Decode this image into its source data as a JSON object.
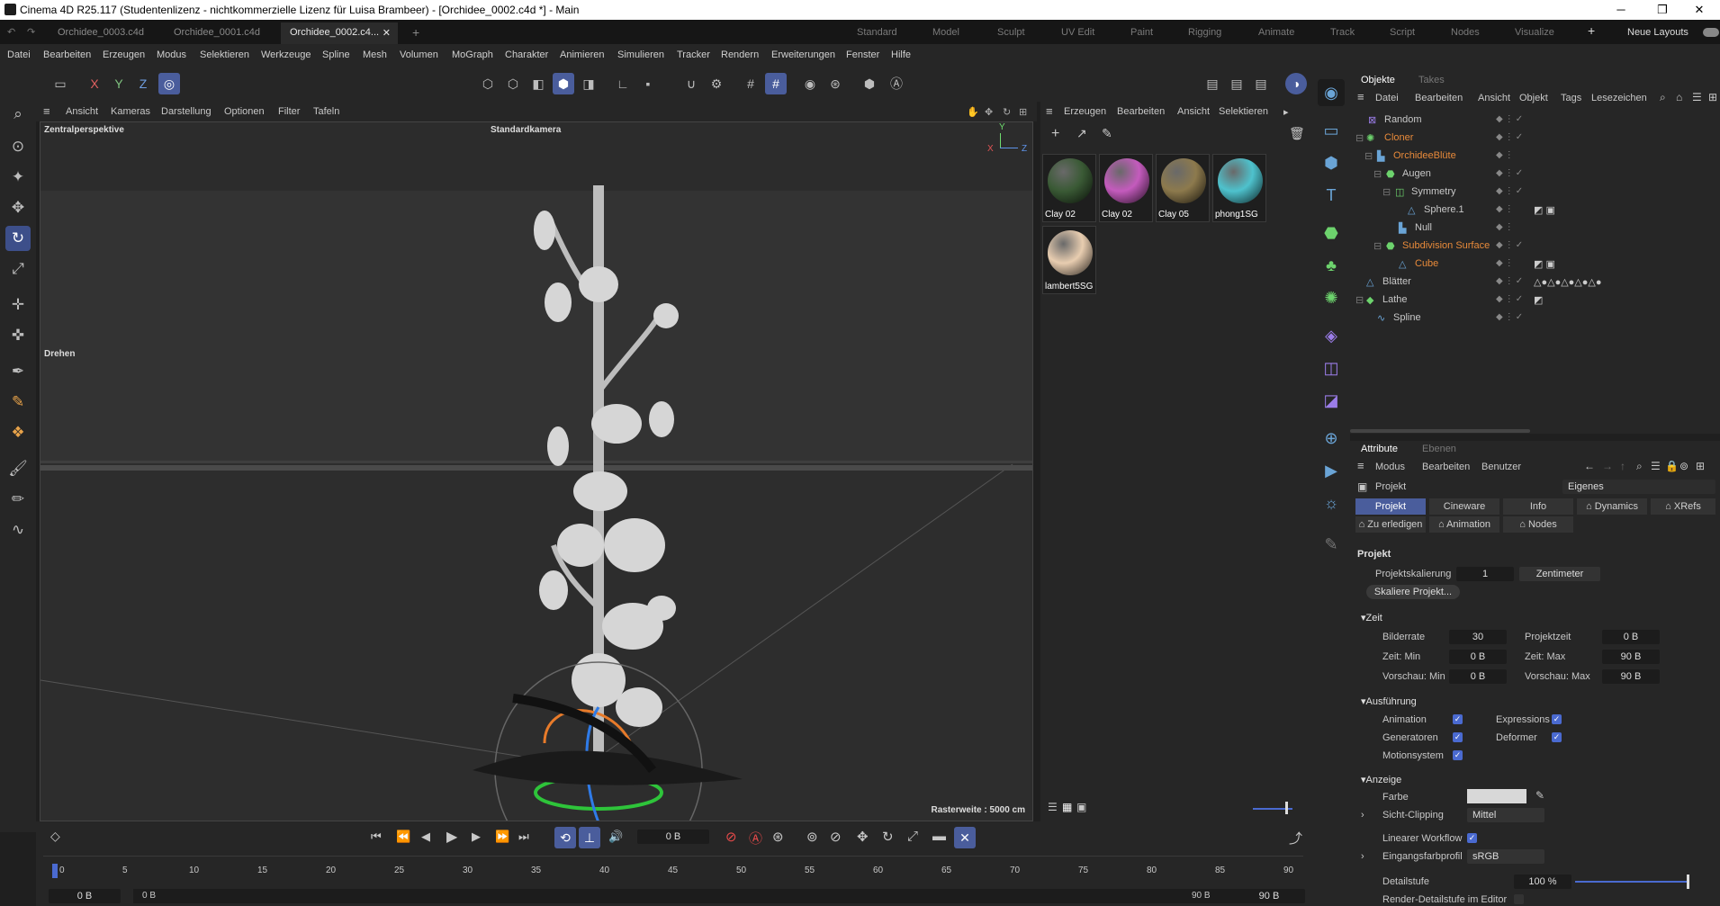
{
  "window": {
    "title": "Cinema 4D R25.117 (Studentenlizenz - nichtkommerzielle Lizenz für Luisa Brambeer) - [Orchidee_0002.c4d *] - Main",
    "minimize": "─",
    "maximize": "❐",
    "close": "✕"
  },
  "doc_tabs": [
    "Orchidee_0003.c4d",
    "Orchidee_0001.c4d",
    "Orchidee_0002.c4...",
    "✕",
    "+"
  ],
  "layouts": [
    "Standard",
    "Model",
    "Sculpt",
    "UV Edit",
    "Paint",
    "Rigging",
    "Animate",
    "Track",
    "Script",
    "Nodes",
    "Visualize"
  ],
  "neue_layouts": "Neue Layouts",
  "menu": [
    "Datei",
    "Bearbeiten",
    "Erzeugen",
    "Modus",
    "Selektieren",
    "Werkzeuge",
    "Spline",
    "Mesh",
    "Volumen",
    "MoGraph",
    "Charakter",
    "Animieren",
    "Simulieren",
    "Tracker",
    "Rendern",
    "Erweiterungen",
    "Fenster",
    "Hilfe"
  ],
  "axes": [
    "X",
    "Y",
    "Z"
  ],
  "viewport": {
    "menu": [
      "Ansicht",
      "Kameras",
      "Darstellung",
      "Optionen",
      "Filter",
      "Tafeln"
    ],
    "label": "Zentralperspektive",
    "camera": "Standardkamera",
    "tool": "Drehen",
    "grid": "Rasterweite : 5000 cm",
    "axis_y": "Y",
    "axis_x": "X",
    "axis_z": "Z"
  },
  "materials": {
    "menu": [
      "Erzeugen",
      "Bearbeiten",
      "Ansicht",
      "Selektieren"
    ],
    "items": [
      {
        "name": "Clay 02",
        "color": "#3a5a35"
      },
      {
        "name": "Clay 02",
        "color": "#c45bbd"
      },
      {
        "name": "Clay 05",
        "color": "#8d7a4d"
      },
      {
        "name": "phong1SG",
        "color": "#4ec2cd"
      },
      {
        "name": "lambert5SG",
        "color": "#e8cdb0"
      }
    ]
  },
  "objects": {
    "tabs": [
      "Objekte",
      "Takes"
    ],
    "menu": [
      "Datei",
      "Bearbeiten",
      "Ansicht",
      "Objekt",
      "Tags",
      "Lesezeichen"
    ],
    "items": [
      {
        "name": "Random",
        "indent": 0,
        "orange": false
      },
      {
        "name": "Cloner",
        "indent": 0,
        "orange": true
      },
      {
        "name": "OrchideeBlüte",
        "indent": 1,
        "orange": true
      },
      {
        "name": "Augen",
        "indent": 2,
        "orange": false
      },
      {
        "name": "Symmetry",
        "indent": 3,
        "orange": false
      },
      {
        "name": "Sphere.1",
        "indent": 4,
        "orange": false
      },
      {
        "name": "Null",
        "indent": 3,
        "orange": false
      },
      {
        "name": "Subdivision Surface",
        "indent": 2,
        "orange": true
      },
      {
        "name": "Cube",
        "indent": 3,
        "orange": true
      },
      {
        "name": "Blätter",
        "indent": 0,
        "orange": false
      },
      {
        "name": "Lathe",
        "indent": 0,
        "orange": false
      },
      {
        "name": "Spline",
        "indent": 1,
        "orange": false
      }
    ]
  },
  "attributes": {
    "tabs": [
      "Attribute",
      "Ebenen"
    ],
    "menu": [
      "Modus",
      "Bearbeiten",
      "Benutzer"
    ],
    "object": "Projekt",
    "dropdown": "Eigenes",
    "subtabs": [
      "Projekt",
      "Cineware",
      "Info",
      "Dynamics",
      "XRefs"
    ],
    "subtabs2": [
      "Zu erledigen",
      "Animation",
      "Nodes"
    ],
    "section": "Projekt",
    "scale_label": "Projektskalierung",
    "scale_value": "1",
    "scale_unit": "Zentimeter",
    "scale_btn": "Skaliere Projekt...",
    "zeit": "Zeit",
    "bilderrate": "Bilderrate",
    "bilderrate_v": "30",
    "projektzeit": "Projektzeit",
    "projektzeit_v": "0 B",
    "zeitmin": "Zeit: Min",
    "zeitmin_v": "0 B",
    "zeitmax": "Zeit: Max",
    "zeitmax_v": "90 B",
    "vormin": "Vorschau: Min",
    "vormin_v": "0 B",
    "vormax": "Vorschau: Max",
    "vormax_v": "90 B",
    "ausf": "Ausführung",
    "animation": "Animation",
    "expressions": "Expressions",
    "generatoren": "Generatoren",
    "deformer": "Deformer",
    "motion": "Motionsystem",
    "anzeige": "Anzeige",
    "farbe": "Farbe",
    "clipping": "Sicht-Clipping",
    "clipping_v": "Mittel",
    "linear": "Linearer Workflow",
    "profil": "Eingangsfarbprofil",
    "profil_v": "sRGB",
    "detail": "Detailstufe",
    "detail_v": "100 %",
    "render_detail": "Render-Detailstufe im Editor"
  },
  "timeline": {
    "frame": "0 B",
    "ticks": [
      "0",
      "5",
      "10",
      "15",
      "20",
      "25",
      "30",
      "35",
      "40",
      "45",
      "50",
      "55",
      "60",
      "65",
      "70",
      "75",
      "80",
      "85",
      "90"
    ],
    "start": "0 B",
    "start2": "0 B",
    "end": "90 B",
    "end2": "90 B"
  }
}
